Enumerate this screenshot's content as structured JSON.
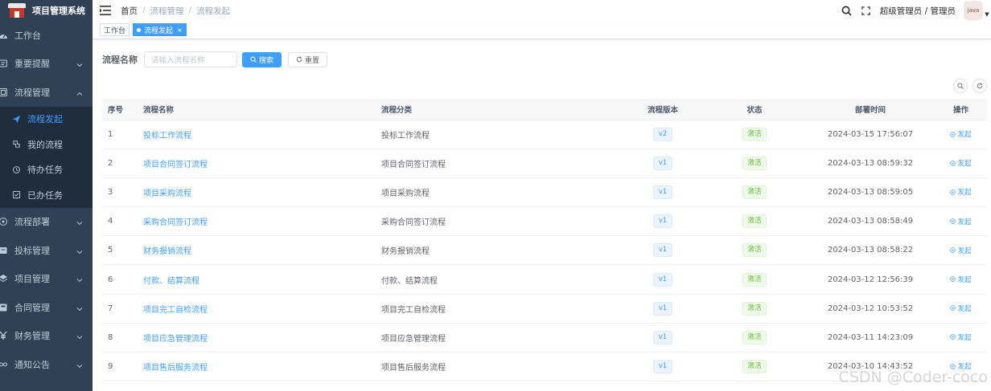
{
  "app": {
    "title": "项目管理系统"
  },
  "sidebar": {
    "items": [
      {
        "label": "工作台",
        "icon": "dashboard-icon",
        "expandable": false
      },
      {
        "label": "重要提醒",
        "icon": "bell-icon",
        "expandable": true
      },
      {
        "label": "流程管理",
        "icon": "workflow-icon",
        "expandable": true,
        "expanded": true,
        "children": [
          {
            "label": "流程发起",
            "icon": "send-icon",
            "active": true
          },
          {
            "label": "我的流程",
            "icon": "list-icon",
            "active": false
          },
          {
            "label": "待办任务",
            "icon": "clock-icon",
            "active": false
          },
          {
            "label": "已办任务",
            "icon": "check-icon",
            "active": false
          }
        ]
      },
      {
        "label": "流程部署",
        "icon": "deploy-icon",
        "expandable": true
      },
      {
        "label": "投标管理",
        "icon": "bid-icon",
        "expandable": true
      },
      {
        "label": "项目管理",
        "icon": "project-icon",
        "expandable": true
      },
      {
        "label": "合同管理",
        "icon": "contract-icon",
        "expandable": true
      },
      {
        "label": "财务管理",
        "icon": "yen-icon",
        "expandable": true
      },
      {
        "label": "通知公告",
        "icon": "notice-icon",
        "expandable": true
      }
    ]
  },
  "header": {
    "breadcrumb": [
      "首页",
      "流程管理",
      "流程发起"
    ],
    "user": "超级管理员 / 管理员",
    "avatar_text": "java"
  },
  "tags": [
    {
      "label": "工作台",
      "active": false
    },
    {
      "label": "流程发起",
      "active": true
    }
  ],
  "search": {
    "label": "流程名称",
    "placeholder": "请输入流程名称",
    "search_btn": "搜索",
    "reset_btn": "重置"
  },
  "table": {
    "headers": [
      "序号",
      "流程名称",
      "流程分类",
      "流程版本",
      "状态",
      "部署时间",
      "操作"
    ],
    "rows": [
      {
        "idx": "1",
        "name": "投标工作流程",
        "category": "投标工作流程",
        "version": "v2",
        "status": "激活",
        "time": "2024-03-15 17:56:07",
        "op": "发起"
      },
      {
        "idx": "2",
        "name": "项目合同签订流程",
        "category": "项目合同签订流程",
        "version": "v1",
        "status": "激活",
        "time": "2024-03-13 08:59:32",
        "op": "发起"
      },
      {
        "idx": "3",
        "name": "项目采购流程",
        "category": "项目采购流程",
        "version": "v1",
        "status": "激活",
        "time": "2024-03-13 08:59:05",
        "op": "发起"
      },
      {
        "idx": "4",
        "name": "采购合同签订流程",
        "category": "采购合同签订流程",
        "version": "v1",
        "status": "激活",
        "time": "2024-03-13 08:58:49",
        "op": "发起"
      },
      {
        "idx": "5",
        "name": "财务报销流程",
        "category": "财务报销流程",
        "version": "v1",
        "status": "激活",
        "time": "2024-03-13 08:58:22",
        "op": "发起"
      },
      {
        "idx": "6",
        "name": "付款、结算流程",
        "category": "付款、结算流程",
        "version": "v1",
        "status": "激活",
        "time": "2024-03-12 12:56:39",
        "op": "发起"
      },
      {
        "idx": "7",
        "name": "项目完工自检流程",
        "category": "项目完工自检流程",
        "version": "v1",
        "status": "激活",
        "time": "2024-03-12 10:53:52",
        "op": "发起"
      },
      {
        "idx": "8",
        "name": "项目应急管理流程",
        "category": "项目应急管理流程",
        "version": "v1",
        "status": "激活",
        "time": "2024-03-11 14:23:09",
        "op": "发起"
      },
      {
        "idx": "9",
        "name": "项目售后服务流程",
        "category": "项目售后服务流程",
        "version": "v1",
        "status": "激活",
        "time": "2024-03-10 14:43:52",
        "op": "发起"
      }
    ]
  },
  "watermark": "CSDN @Coder-coco",
  "colors": {
    "sidebar_bg": "#304156",
    "primary": "#409eff",
    "success": "#67c23a"
  }
}
